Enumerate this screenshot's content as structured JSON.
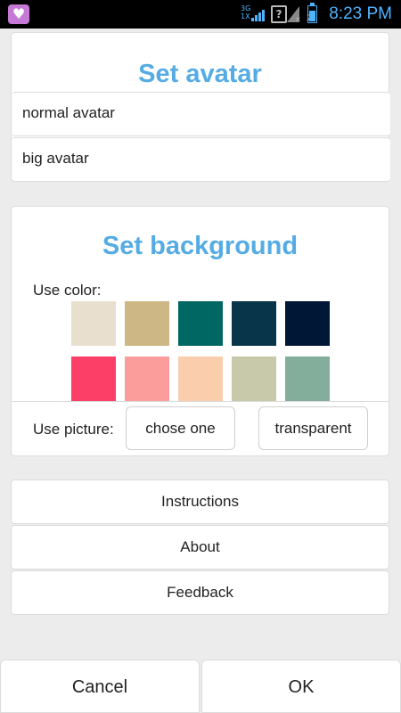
{
  "status_bar": {
    "time": "8:23 PM",
    "network_label": "3G",
    "network_sub": "1X",
    "sim_count": "2",
    "app_icon": "heart-icon",
    "battery_icon": "battery-icon"
  },
  "avatar_section": {
    "title": "Set avatar",
    "options": [
      {
        "label": "normal avatar"
      },
      {
        "label": "big avatar"
      }
    ]
  },
  "background_section": {
    "title": "Set background",
    "use_color_label": "Use color:",
    "colors": [
      "#e8dfcf",
      "#cdb784",
      "#006763",
      "#083549",
      "#001735",
      "#fb3f66",
      "#fb9d9b",
      "#facdac",
      "#c8c9aa",
      "#83ae9b"
    ],
    "use_picture_label": "Use picture:",
    "chose_one_label": "chose one",
    "transparent_label": "transparent"
  },
  "menu": {
    "instructions": "Instructions",
    "about": "About",
    "feedback": "Feedback"
  },
  "footer": {
    "cancel": "Cancel",
    "ok": "OK"
  }
}
